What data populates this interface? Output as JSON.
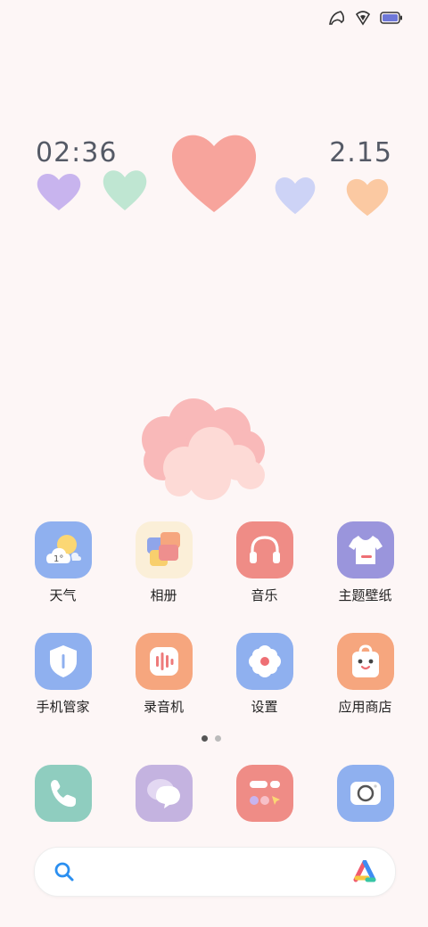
{
  "status": {
    "icons": [
      "signal-icon",
      "wifi-icon",
      "battery-icon"
    ],
    "battery_color": "#6e78d8"
  },
  "widget": {
    "time": "02:36",
    "date": "2.15",
    "heart_colors": [
      "#c8b4ee",
      "#bfe6d2",
      "#f7a49c",
      "#cdd3f6",
      "#fbc9a2"
    ]
  },
  "apps": [
    {
      "label": "天气",
      "icon": "weather-icon",
      "color": "#8fb0ef"
    },
    {
      "label": "相册",
      "icon": "gallery-icon",
      "color": "#fbefd8"
    },
    {
      "label": "音乐",
      "icon": "headphones-icon",
      "color": "#ef8c86"
    },
    {
      "label": "主题壁纸",
      "icon": "theme-shirt-icon",
      "color": "#9a95dc"
    },
    {
      "label": "手机管家",
      "icon": "shield-icon",
      "color": "#8fb0ef"
    },
    {
      "label": "录音机",
      "icon": "recorder-icon",
      "color": "#f6a67e"
    },
    {
      "label": "设置",
      "icon": "gear-icon",
      "color": "#8fb0ef"
    },
    {
      "label": "应用商店",
      "icon": "store-bag-icon",
      "color": "#f6a67e"
    }
  ],
  "weather_temp": "1°",
  "page_dots": {
    "count": 2,
    "active": 0
  },
  "dock": [
    {
      "icon": "phone-icon",
      "color": "#8fcdbf"
    },
    {
      "icon": "messages-icon",
      "color": "#c4b3e0"
    },
    {
      "icon": "tools-icon",
      "color": "#ef8c86"
    },
    {
      "icon": "camera-icon",
      "color": "#8fb0ef"
    }
  ],
  "search": {
    "icon": "search-icon",
    "assistant_icon": "assistant-icon"
  }
}
